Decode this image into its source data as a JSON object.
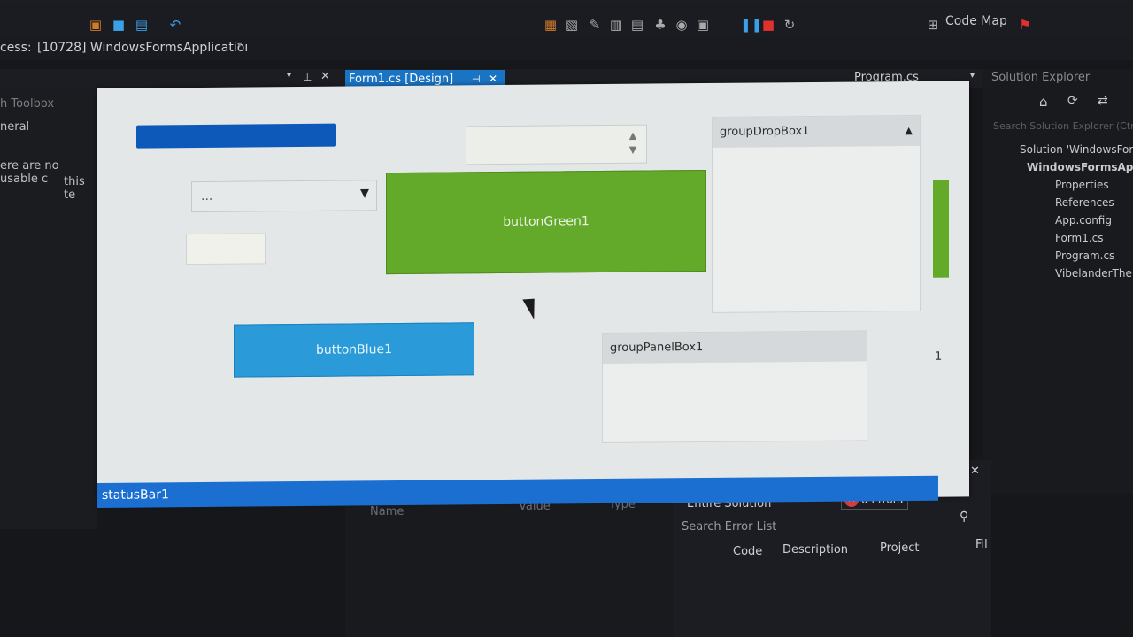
{
  "process": {
    "label": "cess:",
    "value": "[10728] WindowsFormsApplicatioı"
  },
  "toolbar": {
    "code_map": "Code Map"
  },
  "tabs": {
    "form_design": "Form1.cs [Design]",
    "program": "Program.cs"
  },
  "toolbox": {
    "line1": "ox",
    "line2": "h Toolbox",
    "general": "neral",
    "empty1": "ere are no usable c",
    "empty2": "this te"
  },
  "solution_explorer": {
    "title": "Solution Explorer",
    "search_placeholder": "Search Solution Explorer (Ctrl+;)",
    "items": [
      "Solution 'WindowsForm",
      "WindowsFormsApp",
      "Properties",
      "References",
      "App.config",
      "Form1.cs",
      "Program.cs",
      "VibelanderThe"
    ]
  },
  "form": {
    "combo_value": "...",
    "button_green": "buttonGreen1",
    "button_blue": "buttonBlue1",
    "group_drop": "groupDropBox1",
    "group_panel": "groupPanelBox1",
    "status": "statusBar1",
    "side_label": "1"
  },
  "properties": {
    "col_name": "Name",
    "col_value": "Value",
    "col_type": "Type"
  },
  "error_list": {
    "scope": "Entire Solution",
    "errors": "0 Errors",
    "search": "Search Error List",
    "col_code": "Code",
    "col_description": "Description",
    "col_project": "Project",
    "col_file": "Fil"
  },
  "colors": {
    "accent": "#1a74c4",
    "green": "#63a92a",
    "blue": "#2a9ad9",
    "status": "#1a6fd0"
  }
}
